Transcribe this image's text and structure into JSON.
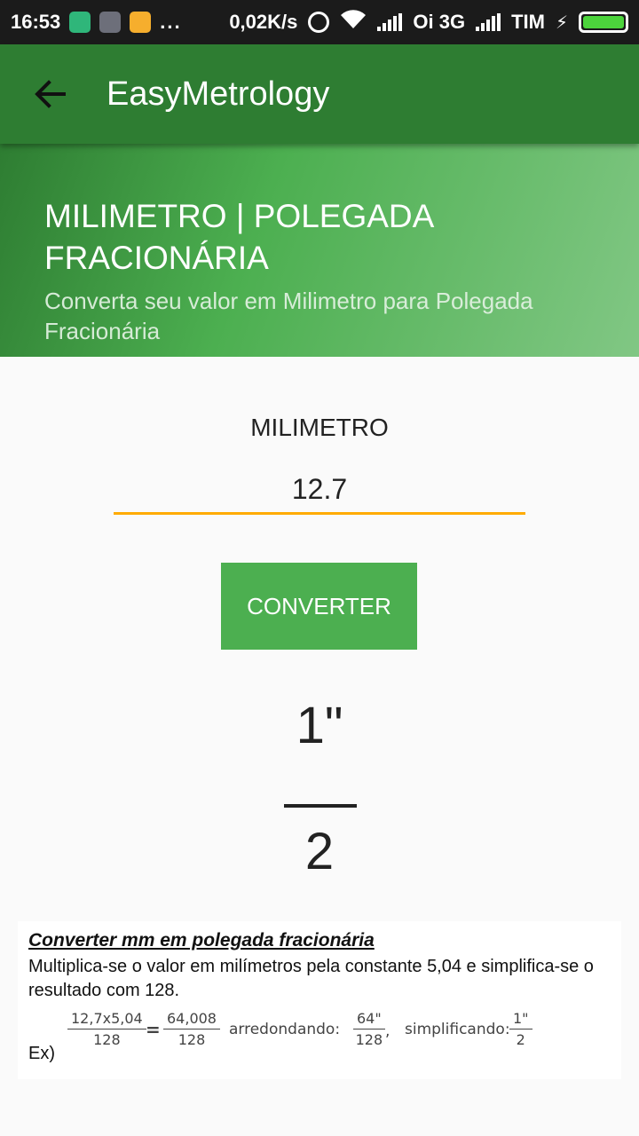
{
  "status_bar": {
    "time": "16:53",
    "dots": "...",
    "speed": "0,02K/s",
    "carrier1": "Oi 3G",
    "carrier2": "TIM"
  },
  "app_bar": {
    "title": "EasyMetrology",
    "back_icon": "arrow-back-icon"
  },
  "banner": {
    "title": "MILIMETRO | POLEGADA FRACIONÁRIA",
    "subtitle": "Converta seu valor em Milimetro para Polegada Fracionária"
  },
  "converter": {
    "input_label": "MILIMETRO",
    "input_value": "12.7",
    "button_label": "CONVERTER",
    "result_numerator": "1\"",
    "result_denominator": "2"
  },
  "explanation": {
    "title": "Converter mm em polegada fracionária",
    "text": "Multiplica-se o valor em milímetros pela constante 5,04 e simplifica-se o resultado com 128.",
    "example_label": "Ex)",
    "step1_num": "12,7x5,04",
    "step1_den": "128",
    "equals": "=",
    "step2_num": "64,008",
    "step2_den": "128",
    "rounding_word": "arredondando:",
    "step3_num": "64\"",
    "step3_den": "128",
    "comma": ",",
    "simplifying_word": "simplificando:",
    "step4_num": "1\"",
    "step4_den": "2"
  },
  "colors": {
    "app_bar": "#2e7d32",
    "button": "#4caf50",
    "input_underline": "#ffab00"
  }
}
